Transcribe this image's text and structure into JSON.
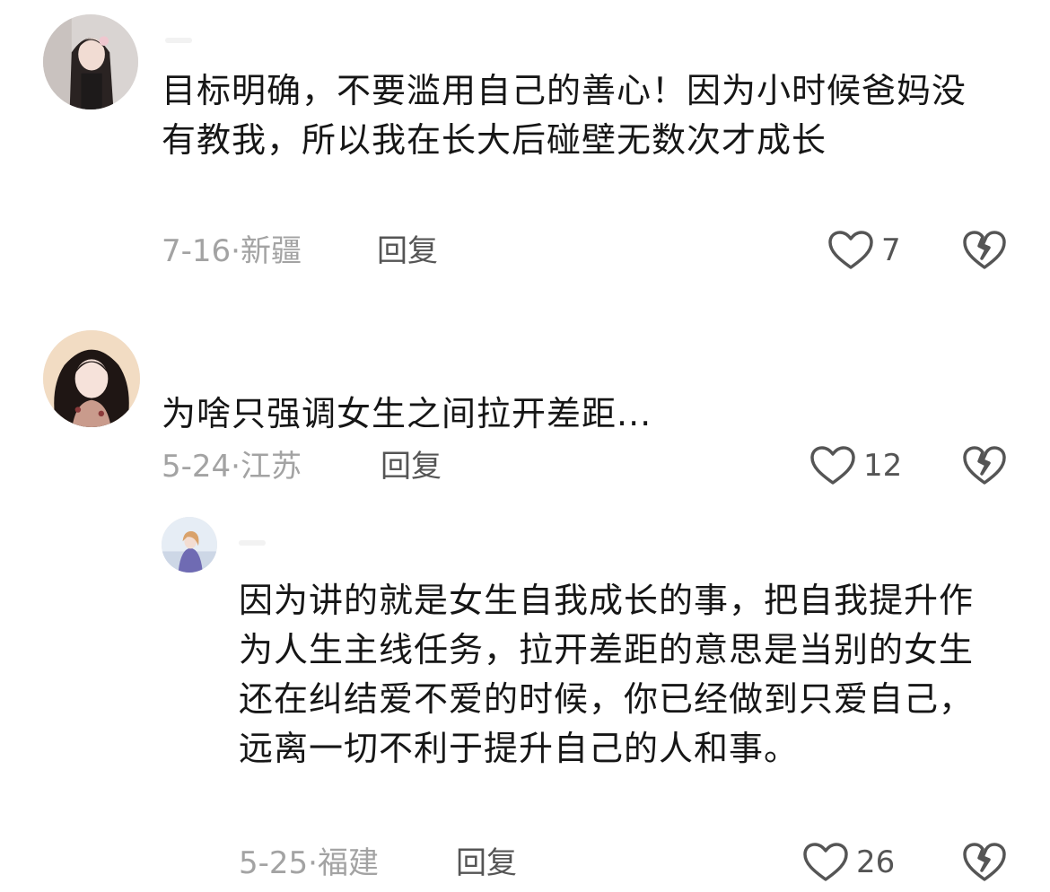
{
  "comments": [
    {
      "text": "目标明确，不要滥用自己的善心！因为小时候爸妈没有教我，所以我在长大后碰壁无数次才成长",
      "date_location": "7-16·新疆",
      "reply_label": "回复",
      "likes": "7",
      "avatar_icon": "avatar-dark-hair-woman"
    },
    {
      "text": "为啥只强调女生之间拉开差距...",
      "date_location": "5-24·江苏",
      "reply_label": "回复",
      "likes": "12",
      "avatar_icon": "avatar-curly-hair-girl"
    },
    {
      "text": "因为讲的就是女生自我成长的事，把自我提升作为人生主线任务，拉开差距的意思是当别的女生还在纠结爱不爱的时候，你已经做到只爱自己，远离一切不利于提升自己的人和事。",
      "date_location": "5-25·福建",
      "reply_label": "回复",
      "likes": "26",
      "avatar_icon": "avatar-illustrated-girl"
    }
  ],
  "colors": {
    "text": "#161616",
    "meta": "#a3a3a3",
    "icon": "#555555"
  }
}
